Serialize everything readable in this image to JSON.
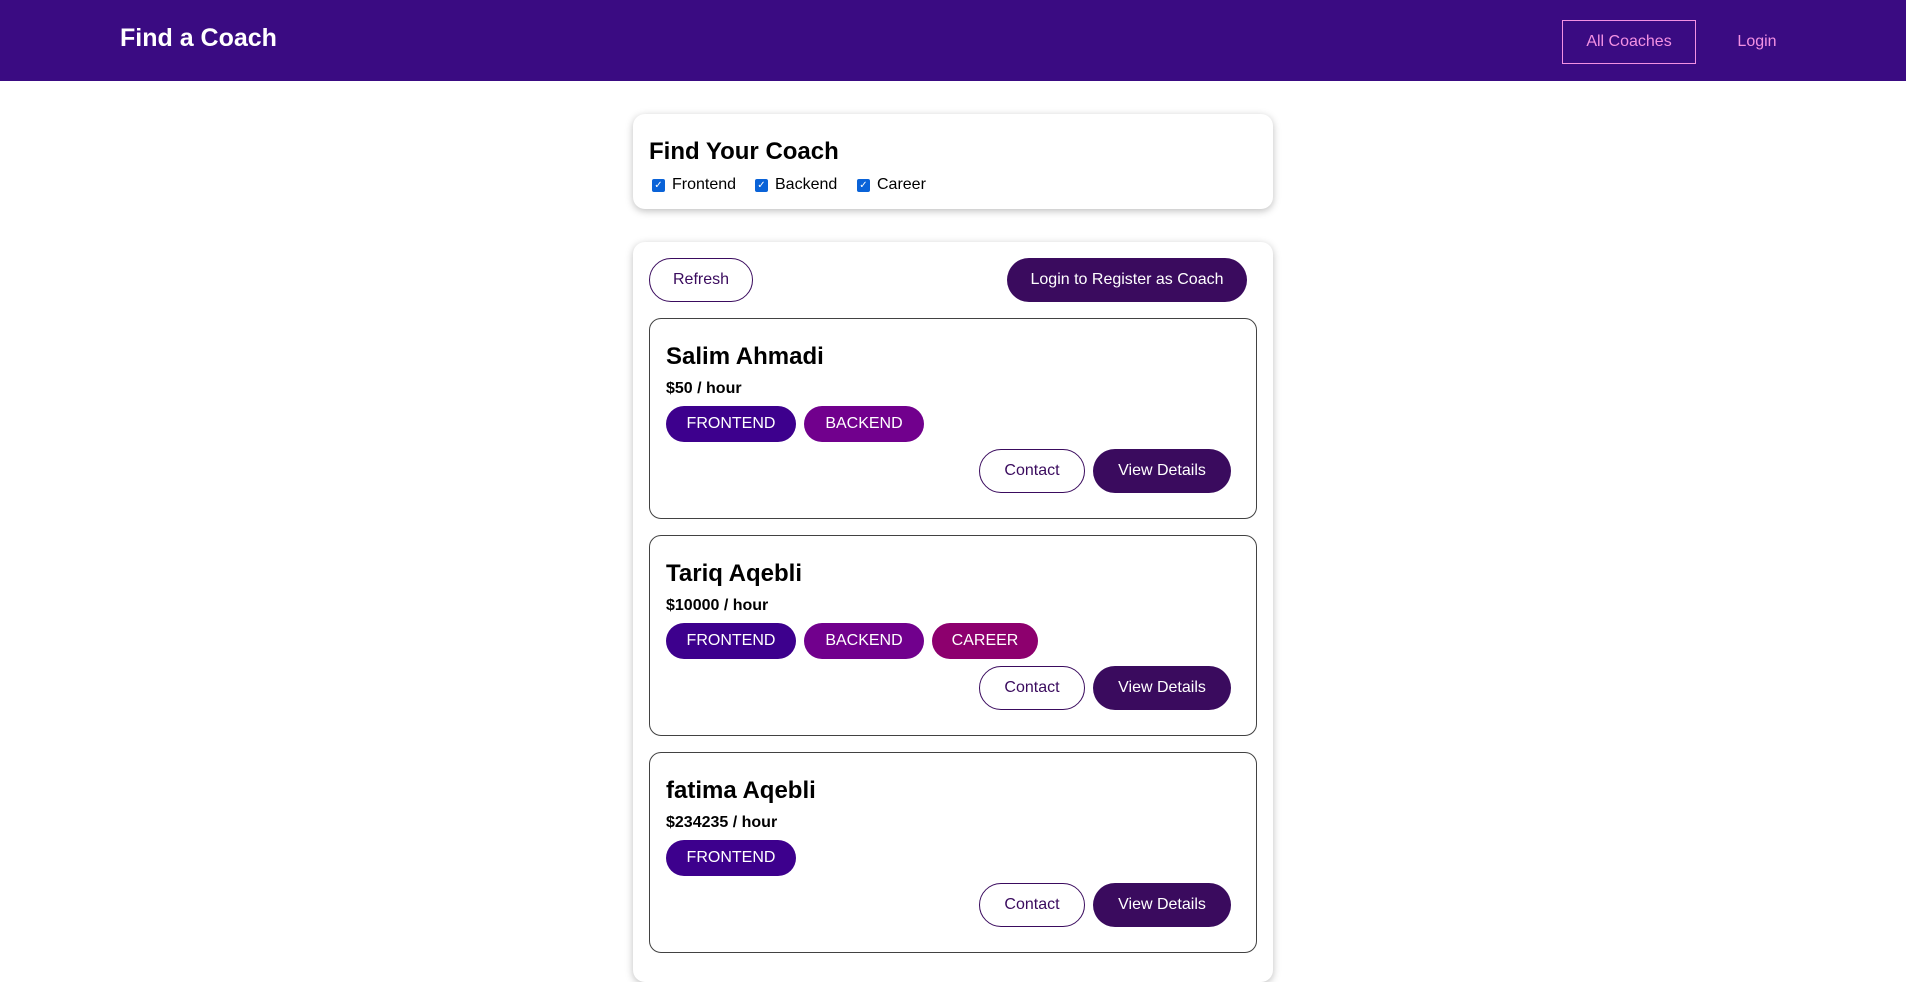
{
  "header": {
    "brand": "Find a Coach",
    "nav": [
      {
        "label": "All Coaches"
      },
      {
        "label": "Login"
      }
    ]
  },
  "filter": {
    "title": "Find Your Coach",
    "options": [
      {
        "label": "Frontend",
        "checked": true
      },
      {
        "label": "Backend",
        "checked": true
      },
      {
        "label": "Career",
        "checked": true
      }
    ]
  },
  "controls": {
    "refresh_label": "Refresh",
    "register_label": "Login to Register as Coach"
  },
  "coaches": [
    {
      "name": "Salim Ahmadi",
      "rate": "$50 / hour",
      "areas": [
        "FRONTEND",
        "BACKEND"
      ],
      "contact_label": "Contact",
      "details_label": "View Details"
    },
    {
      "name": "Tariq Aqebli",
      "rate": "$10000 / hour",
      "areas": [
        "FRONTEND",
        "BACKEND",
        "CAREER"
      ],
      "contact_label": "Contact",
      "details_label": "View Details"
    },
    {
      "name": "fatima Aqebli",
      "rate": "$234235 / hour",
      "areas": [
        "FRONTEND"
      ],
      "contact_label": "Contact",
      "details_label": "View Details"
    }
  ],
  "colors": {
    "header_bg": "#3a0b82",
    "nav_link": "#f391e3",
    "primary_button": "#3a0b5e",
    "badge_frontend": "#3d008d",
    "badge_backend": "#71008d",
    "badge_career": "#8d006e",
    "checkbox": "#0a63d8"
  }
}
